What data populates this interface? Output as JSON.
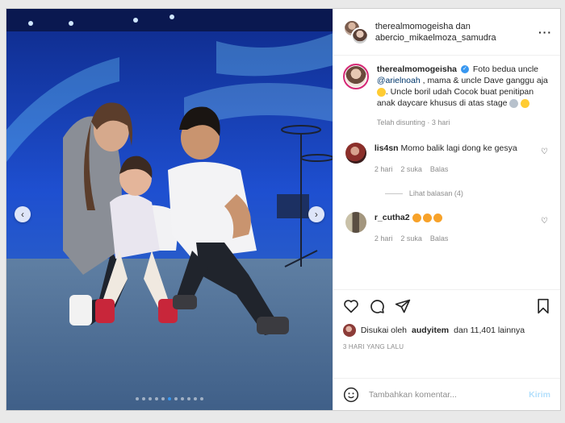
{
  "post": {
    "header": {
      "author1": "therealmomogeisha",
      "connector": "dan",
      "author2": "abercio_mikaelmoza_samudra",
      "more_icon": "more-horizontal-icon"
    },
    "caption": {
      "username": "therealmomogeisha",
      "verified_icon": "verified-badge-icon",
      "text_a": "Foto bedua uncle ",
      "mention": "@arielnoah",
      "text_b": " , mama & uncle Dave ganggu aja",
      "text_c": ". Uncle boril udah Cocok buat penitipan anak daycare khusus di atas stage ",
      "edited": "Telah disunting",
      "time": "3 hari"
    },
    "comments": [
      {
        "username": "lis4sn",
        "text": "Momo balik lagi dong ke gesya",
        "time": "2 hari",
        "likes": "2 suka",
        "reply": "Balas",
        "view_replies": "Lihat balasan (4)"
      },
      {
        "username": "r_cutha2",
        "text": "",
        "time": "2 hari",
        "likes": "2 suka",
        "reply": "Balas"
      }
    ],
    "likes": {
      "prefix": "Disukai oleh",
      "user": "audyitem",
      "suffix": "dan 11,401 lainnya"
    },
    "date": "3 HARI YANG LALU",
    "add_comment": {
      "placeholder": "Tambahkan komentar...",
      "post_label": "Kirim"
    },
    "carousel": {
      "total": 11,
      "active_index": 5
    }
  },
  "colors": {
    "link": "#00376b",
    "accent_blue": "#3897f0",
    "post_disabled": "#b2dffc",
    "muted": "#8e8e8e"
  }
}
